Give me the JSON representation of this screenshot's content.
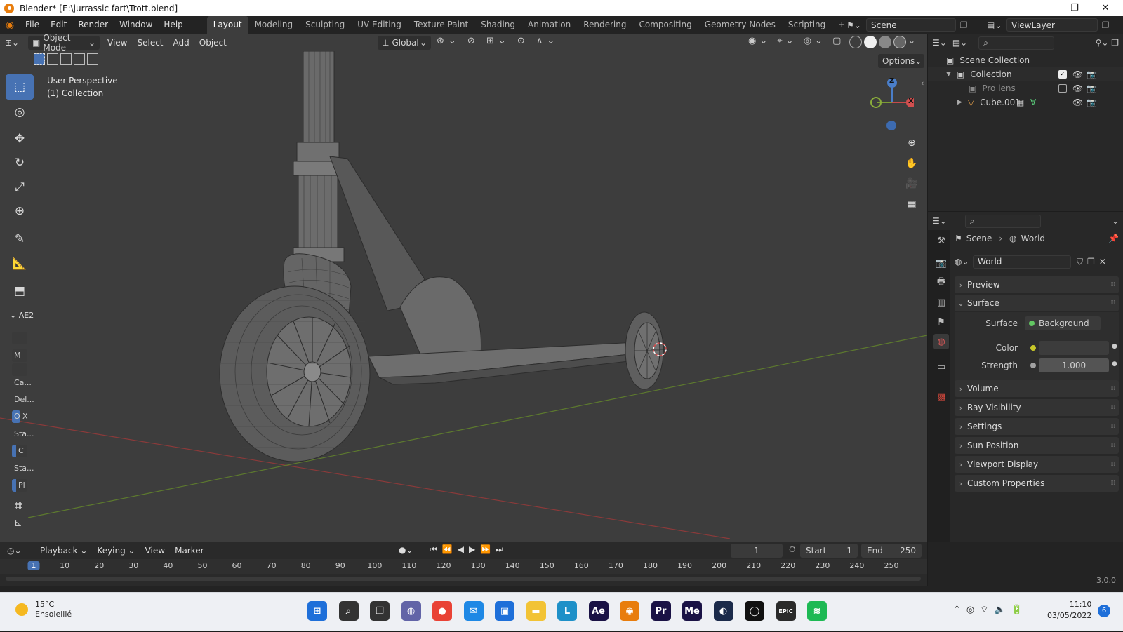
{
  "window": {
    "title": "Blender* [E:\\jurrassic fart\\Trott.blend]",
    "minimize": "—",
    "maximize": "❐",
    "close": "✕"
  },
  "topbar": {
    "menus": [
      "File",
      "Edit",
      "Render",
      "Window",
      "Help"
    ],
    "workspaces": [
      "Layout",
      "Modeling",
      "Sculpting",
      "UV Editing",
      "Texture Paint",
      "Shading",
      "Animation",
      "Rendering",
      "Compositing",
      "Geometry Nodes",
      "Scripting"
    ],
    "active_workspace": "Layout",
    "add_workspace": "+",
    "scene": "Scene",
    "view_layer": "ViewLayer"
  },
  "viewport": {
    "mode": "Object Mode",
    "menus": [
      "View",
      "Select",
      "Add",
      "Object"
    ],
    "orientation": "Global",
    "options_label": "Options",
    "overlay_line1": "User Perspective",
    "overlay_line2": "(1) Collection",
    "gizmo": {
      "z": "Z",
      "x": "X"
    },
    "sidebar_section": "AE2",
    "sidebar_items": [
      "M",
      "Ca...",
      "Del...",
      "O",
      "X",
      "Sta...",
      "C",
      "Sta...",
      "Pl"
    ]
  },
  "outliner": {
    "rows": [
      {
        "label": "Scene Collection",
        "icon": "scene-collection-icon"
      },
      {
        "label": "Collection",
        "icon": "collection-icon"
      },
      {
        "label": "Pro lens",
        "icon": "collection-icon"
      },
      {
        "label": "Cube.001",
        "icon": "mesh-icon"
      }
    ]
  },
  "properties": {
    "breadcrumb_scene": "Scene",
    "breadcrumb_world": "World",
    "world_name": "World",
    "panels": [
      "Preview",
      "Surface",
      "Volume",
      "Ray Visibility",
      "Settings",
      "Sun Position",
      "Viewport Display",
      "Custom Properties"
    ],
    "surface_label": "Surface",
    "surface_value": "Background",
    "color_label": "Color",
    "strength_label": "Strength",
    "strength_value": "1.000",
    "colors": {
      "accent": "#4772b3",
      "socket_green": "#63c763",
      "socket_yellow": "#c7c729"
    }
  },
  "timeline": {
    "menus": [
      "Playback",
      "Keying",
      "View",
      "Marker"
    ],
    "current_frame": "1",
    "start_label": "Start",
    "start_value": "1",
    "end_label": "End",
    "end_value": "250",
    "ticks": [
      "1",
      "10",
      "20",
      "30",
      "40",
      "50",
      "60",
      "70",
      "80",
      "90",
      "100",
      "110",
      "120",
      "130",
      "140",
      "150",
      "160",
      "170",
      "180",
      "190",
      "200",
      "210",
      "220",
      "230",
      "240",
      "250"
    ],
    "version": "3.0.0"
  },
  "taskbar": {
    "weather_temp": "15°C",
    "weather_desc": "Ensoleillé",
    "apps": [
      {
        "name": "windows-start-icon",
        "label": "⊞",
        "color": "#1e6fd9"
      },
      {
        "name": "search-icon",
        "label": "⌕",
        "color": "#333333"
      },
      {
        "name": "task-view-icon",
        "label": "❐",
        "color": "#333333"
      },
      {
        "name": "teams-chat-icon",
        "label": "◍",
        "color": "#6264a7"
      },
      {
        "name": "chrome-icon",
        "label": "●",
        "color": "#e94235"
      },
      {
        "name": "mail-icon",
        "label": "✉",
        "color": "#1e88e5"
      },
      {
        "name": "store-icon",
        "label": "▣",
        "color": "#1e6fd9"
      },
      {
        "name": "explorer-icon",
        "label": "▬",
        "color": "#f2c335"
      },
      {
        "name": "l-app-icon",
        "label": "L",
        "color": "#1e90c8"
      },
      {
        "name": "after-effects-icon",
        "label": "Ae",
        "color": "#1a1245"
      },
      {
        "name": "blender-icon",
        "label": "◉",
        "color": "#e87d0d"
      },
      {
        "name": "premiere-icon",
        "label": "Pr",
        "color": "#1a1245"
      },
      {
        "name": "media-encoder-icon",
        "label": "Me",
        "color": "#1a1245"
      },
      {
        "name": "cinema4d-icon",
        "label": "◐",
        "color": "#1b2a4a"
      },
      {
        "name": "dark-app-icon",
        "label": "◯",
        "color": "#111111"
      },
      {
        "name": "epic-games-icon",
        "label": "EPIC",
        "color": "#2a2a2a"
      },
      {
        "name": "spotify-icon",
        "label": "≋",
        "color": "#1db954"
      }
    ],
    "time": "11:10",
    "date": "03/05/2022",
    "notifications": "6"
  }
}
